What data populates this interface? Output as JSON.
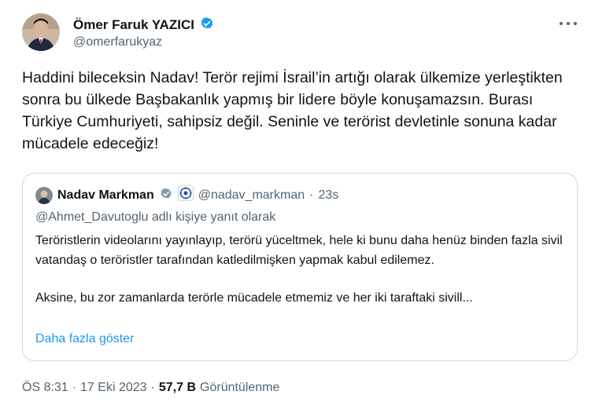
{
  "author": {
    "name": "Ömer Faruk YAZICI",
    "handle": "@omerfarukyaz",
    "verified_color": "#1d9bf0"
  },
  "tweet": {
    "text": "Haddini bileceksin Nadav! Terör rejimi İsrail’in artığı olarak ülkemize yerleştikten sonra bu ülkede Başbakanlık yapmış bir lidere böyle konuşamazsın. Burası Türkiye Cumhuriyeti, sahipsiz değil. Seninle ve terörist devletinle sonuna kadar mücadele edeceğiz!"
  },
  "quote": {
    "name": "Nadav Markman",
    "handle": "@nadav_markman",
    "separator": "·",
    "time": "23s",
    "reply_to": "@Ahmet_Davutoglu adlı kişiye yanıt olarak",
    "paragraph1": "Teröristlerin videolarını yayınlayıp, terörü yüceltmek, hele ki bunu daha henüz binden fazla sivil vatandaş o teröristler tarafından katledilmişken yapmak kabul edilemez.",
    "paragraph2": "Aksine, bu zor zamanlarda terörle mücadele etmemiz ve her iki taraftaki sivill...",
    "show_more": "Daha fazla göster"
  },
  "meta": {
    "time": "ÖS 8:31",
    "sep1": "·",
    "date": "17 Eki 2023",
    "sep2": "·",
    "views": "57,7 B",
    "views_label": "Görüntülenme"
  },
  "icons": [
    "verified-badge-icon",
    "more-options-icon",
    "organization-badge-icon"
  ],
  "colors": {
    "text": "#0f1419",
    "secondary": "#536471",
    "link": "#1d9bf0",
    "border": "#cfd9de"
  }
}
